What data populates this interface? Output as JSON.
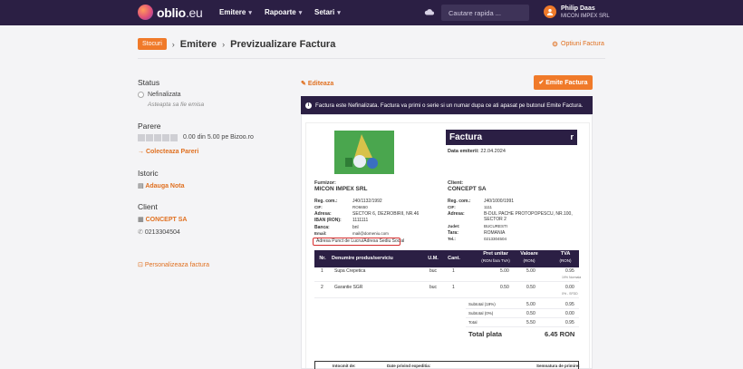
{
  "topbar": {
    "logo_main": "oblio",
    "logo_tld": ".eu",
    "nav": [
      "Emitere",
      "Rapoarte",
      "Setari"
    ],
    "search_placeholder": "Cautare rapida ...",
    "user_name": "Philip Daas",
    "user_company": "MICON IMPEX SRL"
  },
  "breadcrumb": {
    "badge": "Stocuri",
    "level1": "Emitere",
    "level2": "Previzualizare Factura"
  },
  "options_link": "Optiuni Factura",
  "left": {
    "status_title": "Status",
    "status_value": "Nefinalizata",
    "status_hint": "Asteapta sa fie emisa",
    "rating_title": "Parere",
    "rating_text": "0.00 din 5.00 pe Bizoo.ro",
    "rating_value": 0,
    "rating_max": 5,
    "collect_reviews": "Colecteaza Pareri",
    "history_title": "Istoric",
    "add_note": "Adauga Nota",
    "client_title": "Client",
    "client_name": "CONCEPT SA",
    "client_phone": "0213304504",
    "customize": "Personalizeaza factura"
  },
  "actions": {
    "edit": "Editeaza",
    "emit": "Emite Factura"
  },
  "info_message": "Factura este Nefinalizata. Factura va primi o serie si un numar dupa ce ati apasat pe butonul Emite Factura.",
  "invoice": {
    "title": "Factura",
    "title_suffix": "r",
    "date_label": "Data emiterii:",
    "date_value": "22.04.2024",
    "supplier": {
      "heading": "Furnizor:",
      "name": "MICON IMPEX SRL",
      "reg_label": "Reg. com.:",
      "reg_value": "J40/1132/1992",
      "cif_label": "CIF:",
      "cif_value": "RO6650",
      "address_label": "Adresa:",
      "address_value": "SECTOR 6, DEZROBIRII, NR.46",
      "iban_label": "IBAN (RON):",
      "iban_value": "1111111",
      "bank_label": "Banca:",
      "bank_value": "bnl",
      "email_label": "Email:",
      "email_value": "mail@domeniu.com",
      "workpoint": "Adresa Punct de Lucru/Adresa Sediu Social"
    },
    "client": {
      "heading": "Client:",
      "name": "CONCEPT SA",
      "reg_label": "Reg. com.:",
      "reg_value": "J40/1000/1991",
      "cif_label": "CIF:",
      "cif_value": "1111",
      "address_label": "Adresa:",
      "address_line1": "B-DUL PACHE PROTOPOPESCU, NR.100,",
      "address_line2": "SECTOR 2",
      "county_label": "Judet:",
      "county_value": "BUCURESTI",
      "country_label": "Tara:",
      "country_value": "ROMANIA",
      "phone_label": "Tel.:",
      "phone_value": "0213304504"
    },
    "table_headers": {
      "nr": "Nr.",
      "name": "Denumire produs/serviciu",
      "um": "U.M.",
      "qty": "Cant.",
      "unit_price": "Pret unitar",
      "unit_price_sub": "(RON fara TVA)",
      "value": "Valoare",
      "value_sub": "(RON)",
      "vat": "TVA",
      "vat_sub": "(RON)"
    },
    "rows": [
      {
        "nr": "1",
        "name": "Supa Crepetica",
        "um": "buc",
        "qty": "1",
        "price": "5.00",
        "value": "5.00",
        "vat": "0.95",
        "vat_rate": "19% Normala"
      },
      {
        "nr": "2",
        "name": "Garantie SGR",
        "um": "buc",
        "qty": "1",
        "price": "0.50",
        "value": "0.50",
        "vat": "0.00",
        "vat_rate": "0% - SFDD"
      }
    ],
    "totals": [
      {
        "label": "Subtotal (19%)",
        "value": "5.00",
        "vat": "0.95"
      },
      {
        "label": "Subtotal (0%)",
        "value": "0.50",
        "vat": "0.00"
      },
      {
        "label": "Total",
        "value": "5.50",
        "vat": "0.95"
      }
    ],
    "total_label": "Total plata",
    "total_value": "6.45 RON",
    "footer": {
      "col1": "Intocmit de:",
      "col2": "Date privind expeditia:",
      "col3": "Semnatura de primire:"
    }
  }
}
